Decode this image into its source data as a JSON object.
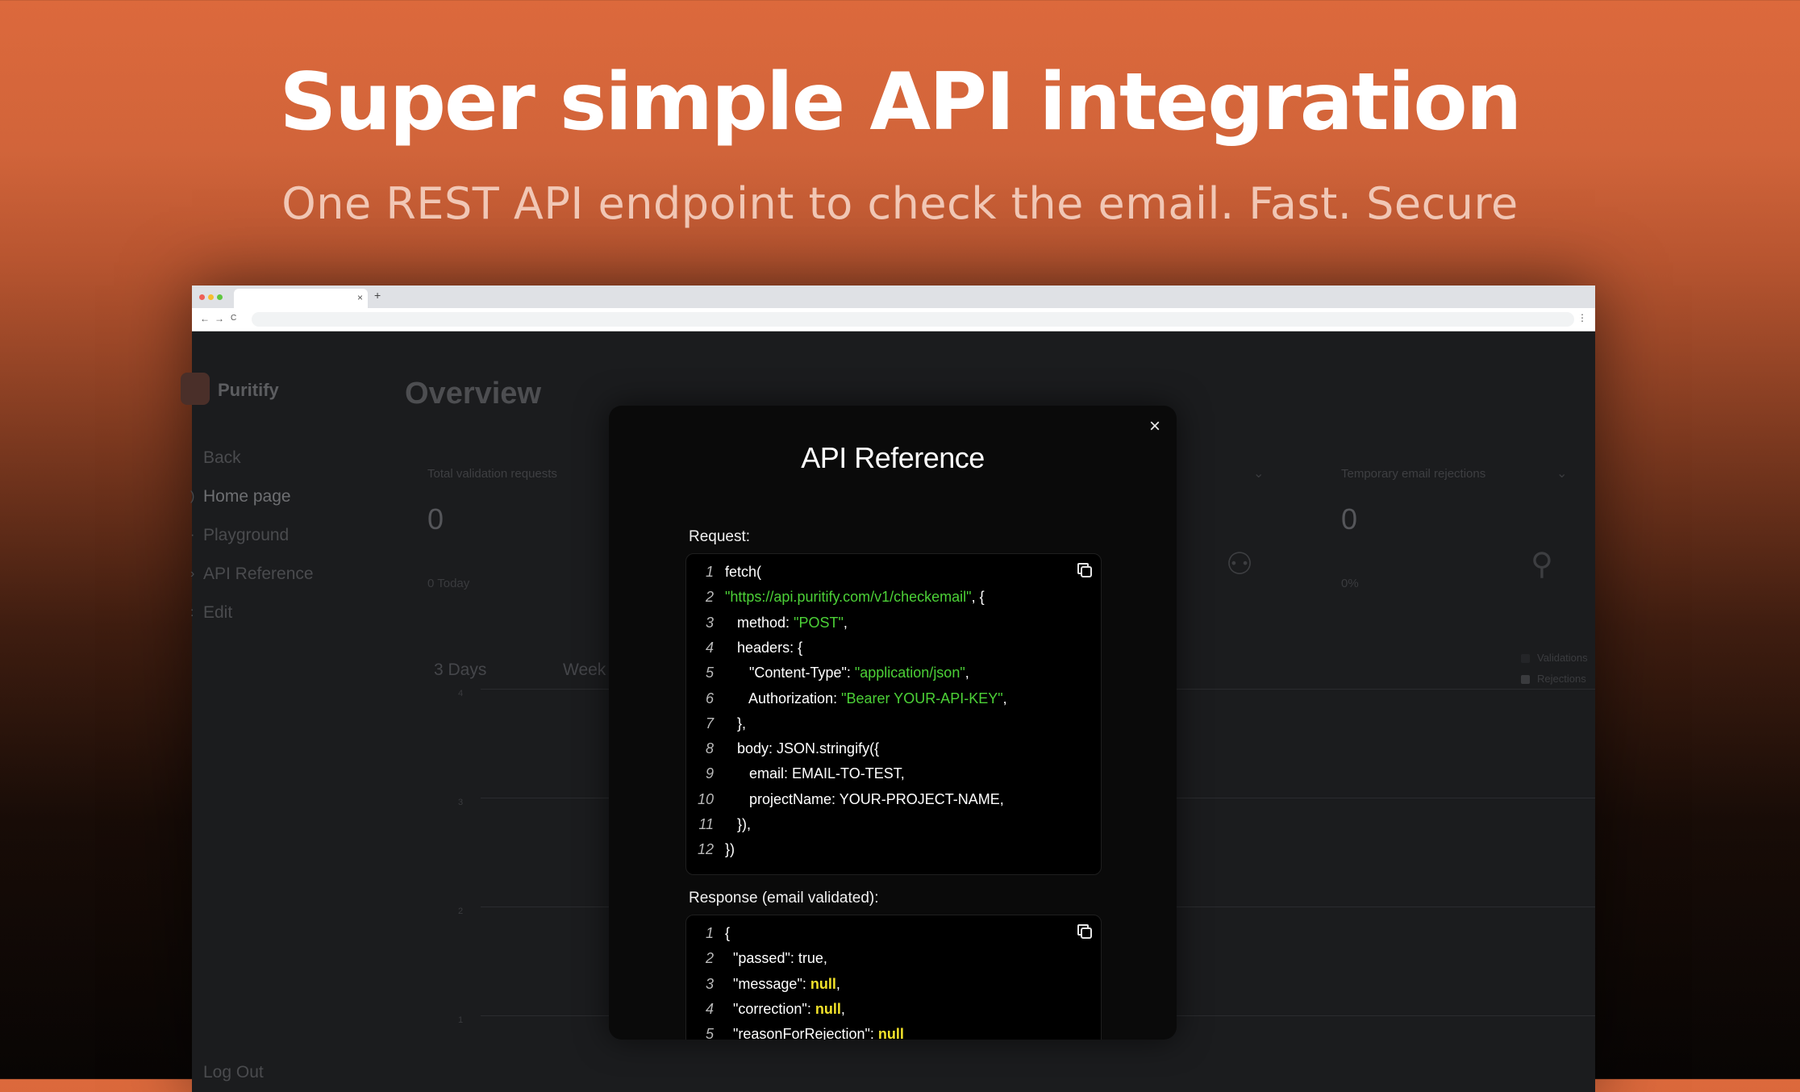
{
  "hero": {
    "title": "Super simple API integration",
    "subtitle": "One REST API endpoint to check the email. Fast. Secure"
  },
  "browser": {
    "tab_close": "×",
    "new_tab": "+",
    "back": "←",
    "forward": "→",
    "reload": "C",
    "menu": "⋮"
  },
  "sidebar": {
    "brand": "Puritify",
    "items": [
      {
        "label": "Back"
      },
      {
        "label": "Home page"
      },
      {
        "label": "Playground"
      },
      {
        "label": "API Reference"
      },
      {
        "label": "Edit"
      }
    ],
    "logout": "Log Out"
  },
  "dashboard": {
    "title": "Overview",
    "cards": [
      {
        "label": "Total validation requests",
        "value": "0",
        "sub": "0 Today"
      },
      {
        "label": "Temporary email rejections",
        "value": "0",
        "sub": "0%"
      }
    ],
    "ranges": [
      "3 Days",
      "Week"
    ],
    "legend": [
      "Validations",
      "Rejections"
    ],
    "yticks": [
      "4",
      "3",
      "2",
      "1"
    ]
  },
  "modal": {
    "title": "API Reference",
    "close": "×",
    "request_label": "Request:",
    "response_label": "Response (email validated):",
    "request_lines": [
      {
        "n": "1",
        "indent": "",
        "parts": [
          {
            "t": "fetch(",
            "c": "plain"
          }
        ]
      },
      {
        "n": "2",
        "indent": "",
        "parts": [
          {
            "t": "\"https://api.puritify.com/v1/checkemail\"",
            "c": "str"
          },
          {
            "t": ", {",
            "c": "plain"
          }
        ]
      },
      {
        "n": "3",
        "indent": "   ",
        "parts": [
          {
            "t": "method: ",
            "c": "plain"
          },
          {
            "t": "\"POST\"",
            "c": "str"
          },
          {
            "t": ",",
            "c": "plain"
          }
        ]
      },
      {
        "n": "4",
        "indent": "   ",
        "parts": [
          {
            "t": "headers: {",
            "c": "plain"
          }
        ]
      },
      {
        "n": "5",
        "indent": "      ",
        "parts": [
          {
            "t": "\"Content-Type\": ",
            "c": "plain"
          },
          {
            "t": "\"application/json\"",
            "c": "str"
          },
          {
            "t": ",",
            "c": "plain"
          }
        ]
      },
      {
        "n": "6",
        "indent": "      ",
        "parts": [
          {
            "t": "Authorization: ",
            "c": "plain"
          },
          {
            "t": "\"Bearer YOUR-API-KEY\"",
            "c": "str"
          },
          {
            "t": ",",
            "c": "plain"
          }
        ]
      },
      {
        "n": "7",
        "indent": "   ",
        "parts": [
          {
            "t": "},",
            "c": "plain"
          }
        ]
      },
      {
        "n": "8",
        "indent": "   ",
        "parts": [
          {
            "t": "body: JSON.stringify({",
            "c": "plain"
          }
        ]
      },
      {
        "n": "9",
        "indent": "      ",
        "parts": [
          {
            "t": "email: EMAIL-TO-TEST,",
            "c": "plain"
          }
        ]
      },
      {
        "n": "10",
        "indent": "      ",
        "parts": [
          {
            "t": "projectName: YOUR-PROJECT-NAME,",
            "c": "plain"
          }
        ]
      },
      {
        "n": "11",
        "indent": "   ",
        "parts": [
          {
            "t": "}),",
            "c": "plain"
          }
        ]
      },
      {
        "n": "12",
        "indent": "",
        "parts": [
          {
            "t": "})",
            "c": "plain"
          }
        ]
      }
    ],
    "response_lines": [
      {
        "n": "1",
        "indent": "",
        "parts": [
          {
            "t": "{",
            "c": "plain"
          }
        ]
      },
      {
        "n": "2",
        "indent": "  ",
        "parts": [
          {
            "t": "\"passed\": true,",
            "c": "plain"
          }
        ]
      },
      {
        "n": "3",
        "indent": "  ",
        "parts": [
          {
            "t": "\"message\": ",
            "c": "plain"
          },
          {
            "t": "null",
            "c": "null"
          },
          {
            "t": ",",
            "c": "plain"
          }
        ]
      },
      {
        "n": "4",
        "indent": "  ",
        "parts": [
          {
            "t": "\"correction\": ",
            "c": "plain"
          },
          {
            "t": "null",
            "c": "null"
          },
          {
            "t": ",",
            "c": "plain"
          }
        ]
      },
      {
        "n": "5",
        "indent": "  ",
        "parts": [
          {
            "t": "\"reasonForRejection\": ",
            "c": "plain"
          },
          {
            "t": "null",
            "c": "null"
          }
        ]
      }
    ]
  }
}
